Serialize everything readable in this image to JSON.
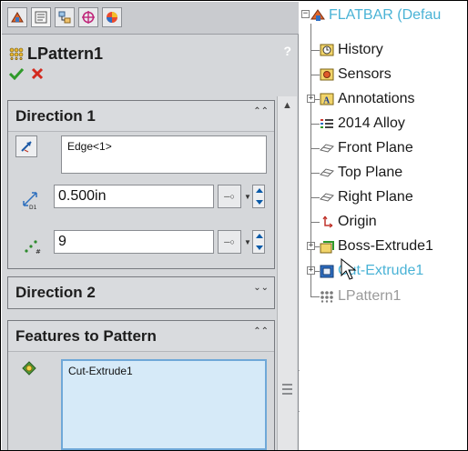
{
  "property_manager": {
    "tabs": [
      "feature-manager",
      "property-manager",
      "configuration-manager",
      "dimxpert-manager",
      "display-manager"
    ],
    "title": "LPattern1",
    "help": "?",
    "ok_icon": "check-icon",
    "cancel_icon": "x-icon",
    "direction1": {
      "header": "Direction 1",
      "edge_value": "Edge<1>",
      "spacing_value": "0.500in",
      "instances_value": "9"
    },
    "direction2": {
      "header": "Direction 2"
    },
    "features": {
      "header": "Features to Pattern",
      "item": "Cut-Extrude1"
    }
  },
  "feature_tree": {
    "root": "FLATBAR  (Defau",
    "items": [
      {
        "label": "History",
        "icon": "history-icon"
      },
      {
        "label": "Sensors",
        "icon": "sensors-icon"
      },
      {
        "label": "Annotations",
        "icon": "annotations-icon"
      },
      {
        "label": "2014 Alloy",
        "icon": "material-icon"
      },
      {
        "label": "Front Plane",
        "icon": "plane-icon"
      },
      {
        "label": "Top Plane",
        "icon": "plane-icon"
      },
      {
        "label": "Right Plane",
        "icon": "plane-icon"
      },
      {
        "label": "Origin",
        "icon": "origin-icon"
      },
      {
        "label": "Boss-Extrude1",
        "icon": "boss-extrude-icon"
      },
      {
        "label": "Cut-Extrude1",
        "icon": "cut-extrude-icon"
      },
      {
        "label": "LPattern1",
        "icon": "linear-pattern-icon"
      }
    ]
  },
  "colors": {
    "highlight_blue": "#4ab3d6",
    "gray_text": "#9a9a9a",
    "panel_bg": "#d5d7da",
    "selection_box": "#d6eaf8"
  }
}
